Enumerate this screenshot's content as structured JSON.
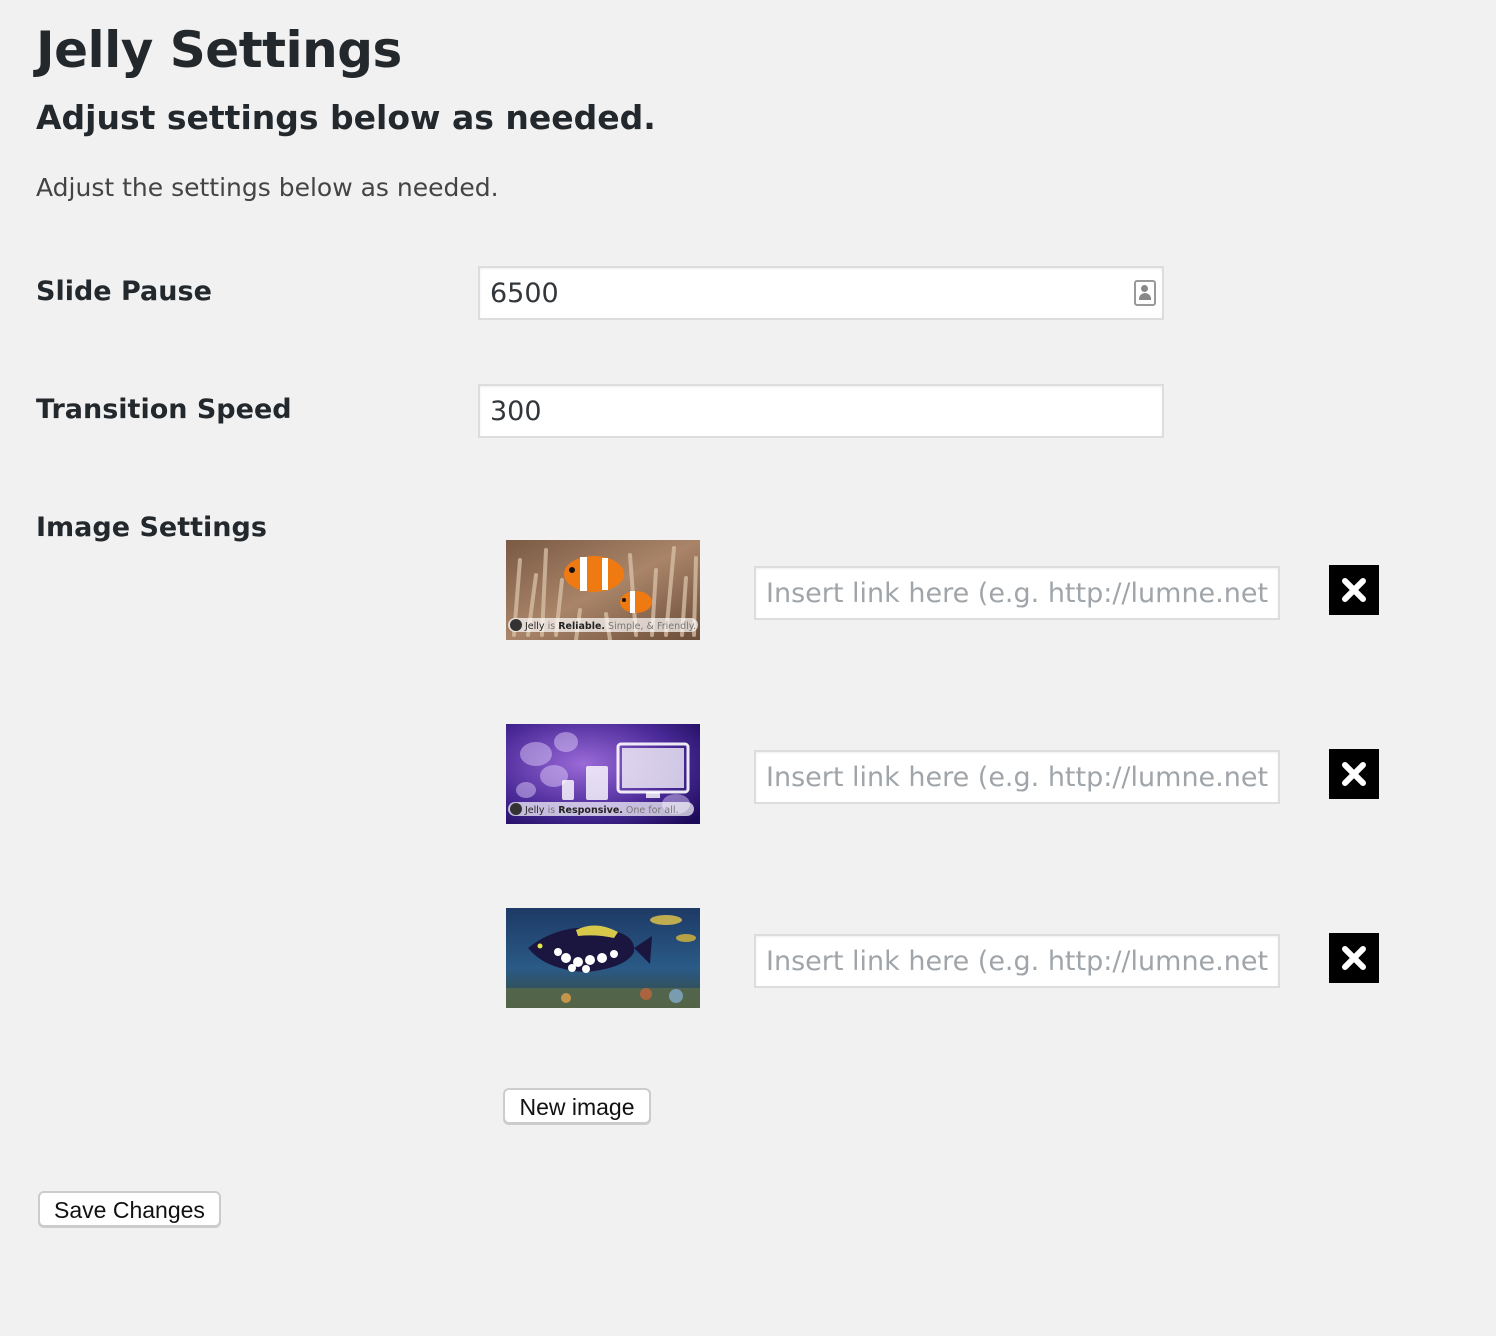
{
  "page": {
    "title": "Jelly Settings",
    "section_title": "Adjust settings below as needed.",
    "intro": "Adjust the settings below as needed."
  },
  "fields": {
    "slide_pause": {
      "label": "Slide Pause",
      "value": "6500"
    },
    "transition_speed": {
      "label": "Transition Speed",
      "value": "300"
    }
  },
  "image_settings": {
    "label": "Image Settings",
    "link_placeholder": "Insert link here (e.g. http://lumne.net)",
    "images": [
      {
        "name": "clownfish",
        "caption_brand": "Jelly",
        "caption_is": "is",
        "caption_bold": "Reliable.",
        "caption_rest": "Simple, & Friendly.",
        "link": ""
      },
      {
        "name": "jellyfish",
        "caption_brand": "Jelly",
        "caption_is": "is",
        "caption_bold": "Responsive.",
        "caption_rest": "One for all.",
        "link": ""
      },
      {
        "name": "triggerfish",
        "link": ""
      }
    ],
    "remove_icon": "close-icon",
    "new_image_label": "New image"
  },
  "actions": {
    "save_label": "Save Changes"
  },
  "colors": {
    "background": "#f1f1f1",
    "text": "#23282d",
    "remove_button": "#000000",
    "input_border": "#dddddd"
  }
}
